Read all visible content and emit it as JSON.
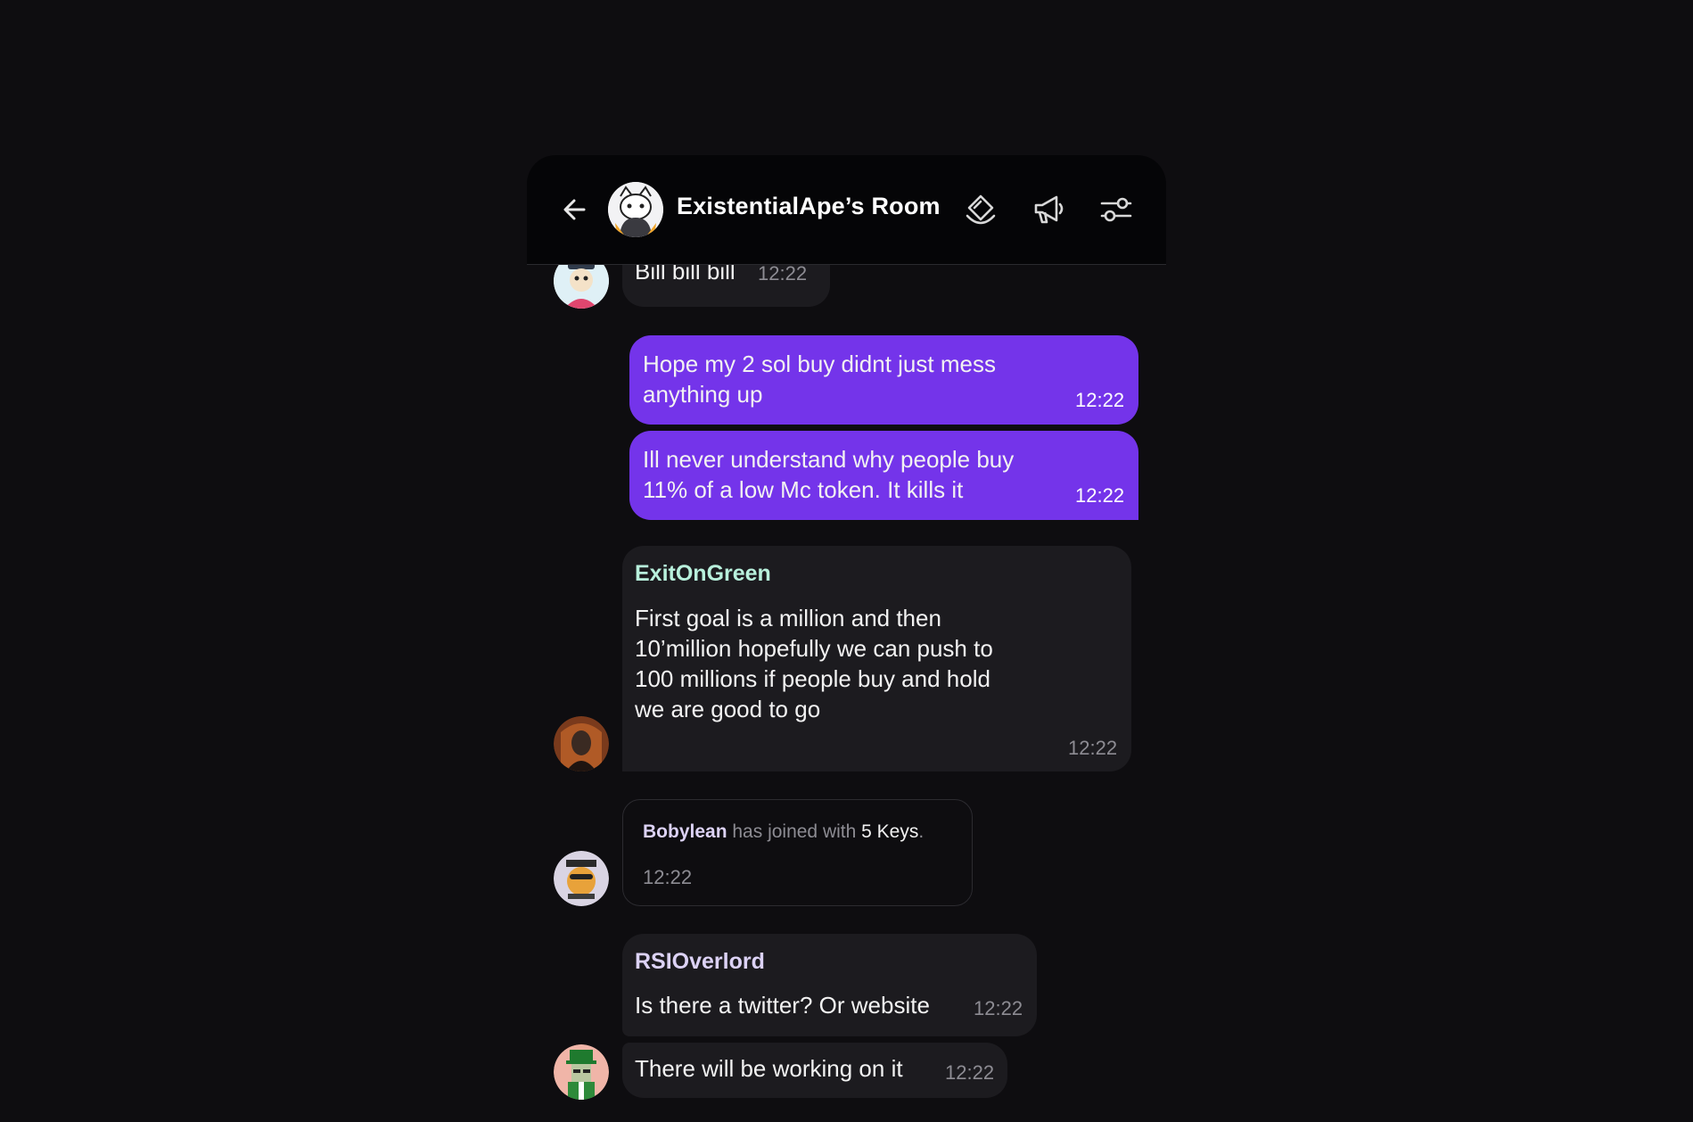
{
  "header": {
    "room_title": "ExistentialApe’s Room"
  },
  "icons": {
    "back": "arrow-left-icon",
    "keys": "diamond-key-icon",
    "announce": "megaphone-icon",
    "settings": "sliders-icon"
  },
  "colors": {
    "background": "#0e0d10",
    "header": "#050507",
    "bubble_dark": "#1c1b1f",
    "bubble_own": "#7434ea",
    "sender_green": "#b8f0dc",
    "sender_lilac": "#dcd2f5"
  },
  "messages": {
    "m1": {
      "text": "Bill bill bill",
      "time": "12:22"
    },
    "m2": {
      "line1": "Hope my 2 sol buy didnt just mess",
      "line2": "anything up",
      "time": "12:22"
    },
    "m3": {
      "line1": "Ill never understand why people buy",
      "line2": "11% of a low Mc token. It kills it",
      "time": "12:22"
    },
    "m4": {
      "sender": "ExitOnGreen",
      "line1": "First goal is a million and then",
      "line2": "10’million hopefully we can push to",
      "line3": "100 millions if people buy and hold",
      "line4": "we are good to go",
      "time": "12:22"
    },
    "m5": {
      "user": "Bobylean",
      "action": "has joined with",
      "amount": "5 Keys",
      "period": ".",
      "time": "12:22"
    },
    "m6": {
      "sender": "RSIOverlord",
      "text": "Is there a twitter? Or website",
      "time": "12:22"
    },
    "m7": {
      "text": "There will be working on it",
      "time": "12:22"
    }
  }
}
